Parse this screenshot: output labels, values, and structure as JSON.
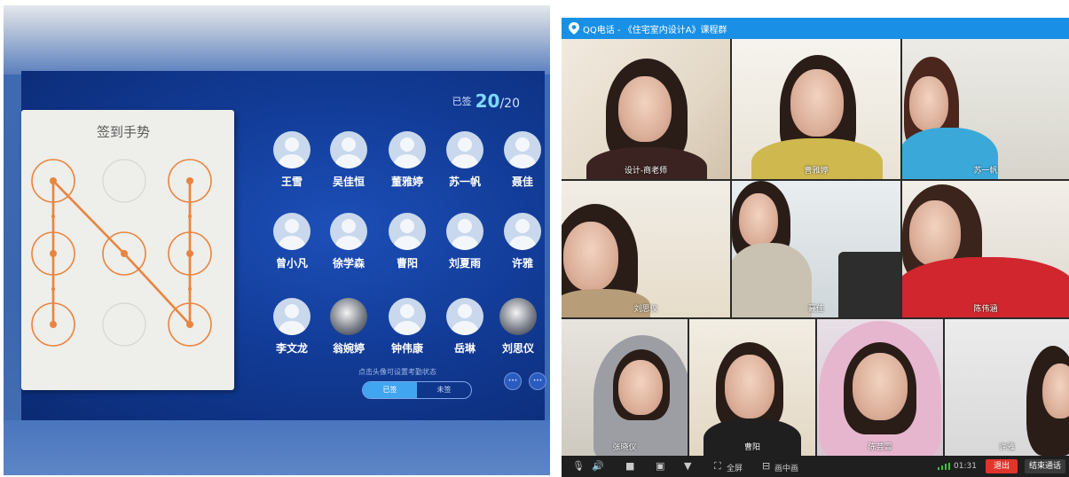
{
  "gesture_panel": {
    "title": "签到手势",
    "signed_label": "已签",
    "signed_count": "20",
    "signed_total": "/20",
    "students": [
      "王雪",
      "吴佳恒",
      "董雅婷",
      "苏一帆",
      "聂佳",
      "曾小凡",
      "徐学森",
      "曹阳",
      "刘夏雨",
      "许雅",
      "李文龙",
      "翁婉婷",
      "钟伟康",
      "岳琳",
      "刘思仪"
    ],
    "hint": "点击头像可设置考勤状态",
    "toggle": [
      "已签",
      "未签"
    ],
    "accent_color": "#41a5f0"
  },
  "call": {
    "title": "QQ电话 - 《住宅室内设计A》课程群",
    "participants": [
      "设计-商老师",
      "曹雅婷",
      "苏一帆",
      "刘思仪",
      "聂佳",
      "陈伟涵",
      "张晓仪",
      "曹阳",
      "陈芸霏",
      "许雅"
    ],
    "toolbar": {
      "fullscreen": "全屏",
      "pip": "画中画",
      "duration": "01:31",
      "exit": "退出",
      "end_call": "结束通话"
    },
    "title_bar_color": "#1990e6",
    "exit_color": "#e0352b"
  }
}
